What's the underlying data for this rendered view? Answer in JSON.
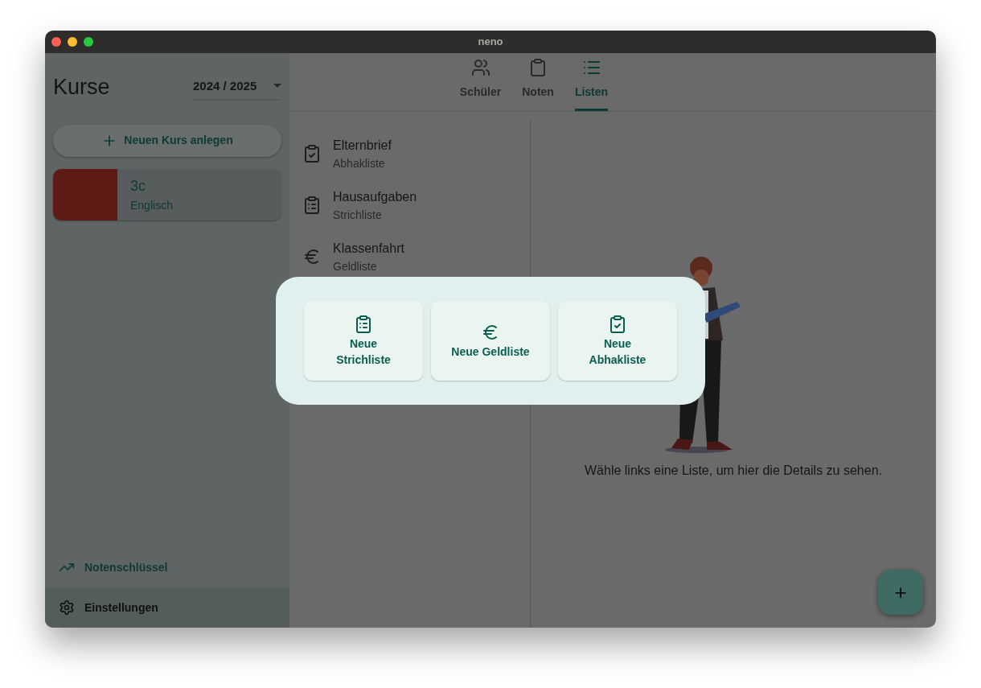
{
  "window": {
    "title": "neno"
  },
  "sidebar": {
    "title": "Kurse",
    "school_year": "2024 / 2025",
    "new_course_button": "Neuen Kurs anlegen",
    "courses": [
      {
        "name": "3c",
        "subject": "Englisch",
        "color": "#5e1b16"
      }
    ],
    "bottom_items": [
      {
        "kind": "grading",
        "label": "Notenschlüssel",
        "selected": false
      },
      {
        "kind": "settings",
        "label": "Einstellungen",
        "selected": true
      }
    ]
  },
  "tabs": [
    {
      "kind": "students",
      "label": "Schüler",
      "selected": false
    },
    {
      "kind": "grades",
      "label": "Noten",
      "selected": false
    },
    {
      "kind": "lists",
      "label": "Listen",
      "selected": true
    }
  ],
  "lists": [
    {
      "kind": "check",
      "title": "Elternbrief",
      "subtitle": "Abhakliste"
    },
    {
      "kind": "tally",
      "title": "Hausaufgaben",
      "subtitle": "Strichliste"
    },
    {
      "kind": "money",
      "title": "Klassenfahrt",
      "subtitle": "Geldliste"
    }
  ],
  "empty_state": "Wähle links eine Liste, um hier die Details zu sehen.",
  "dialog": {
    "options": [
      {
        "kind": "tally",
        "label": "Neue\nStrichliste"
      },
      {
        "kind": "money",
        "label": "Neue Geldliste"
      },
      {
        "kind": "check",
        "label": "Neue\nAbhakliste"
      }
    ]
  },
  "fab": "+"
}
